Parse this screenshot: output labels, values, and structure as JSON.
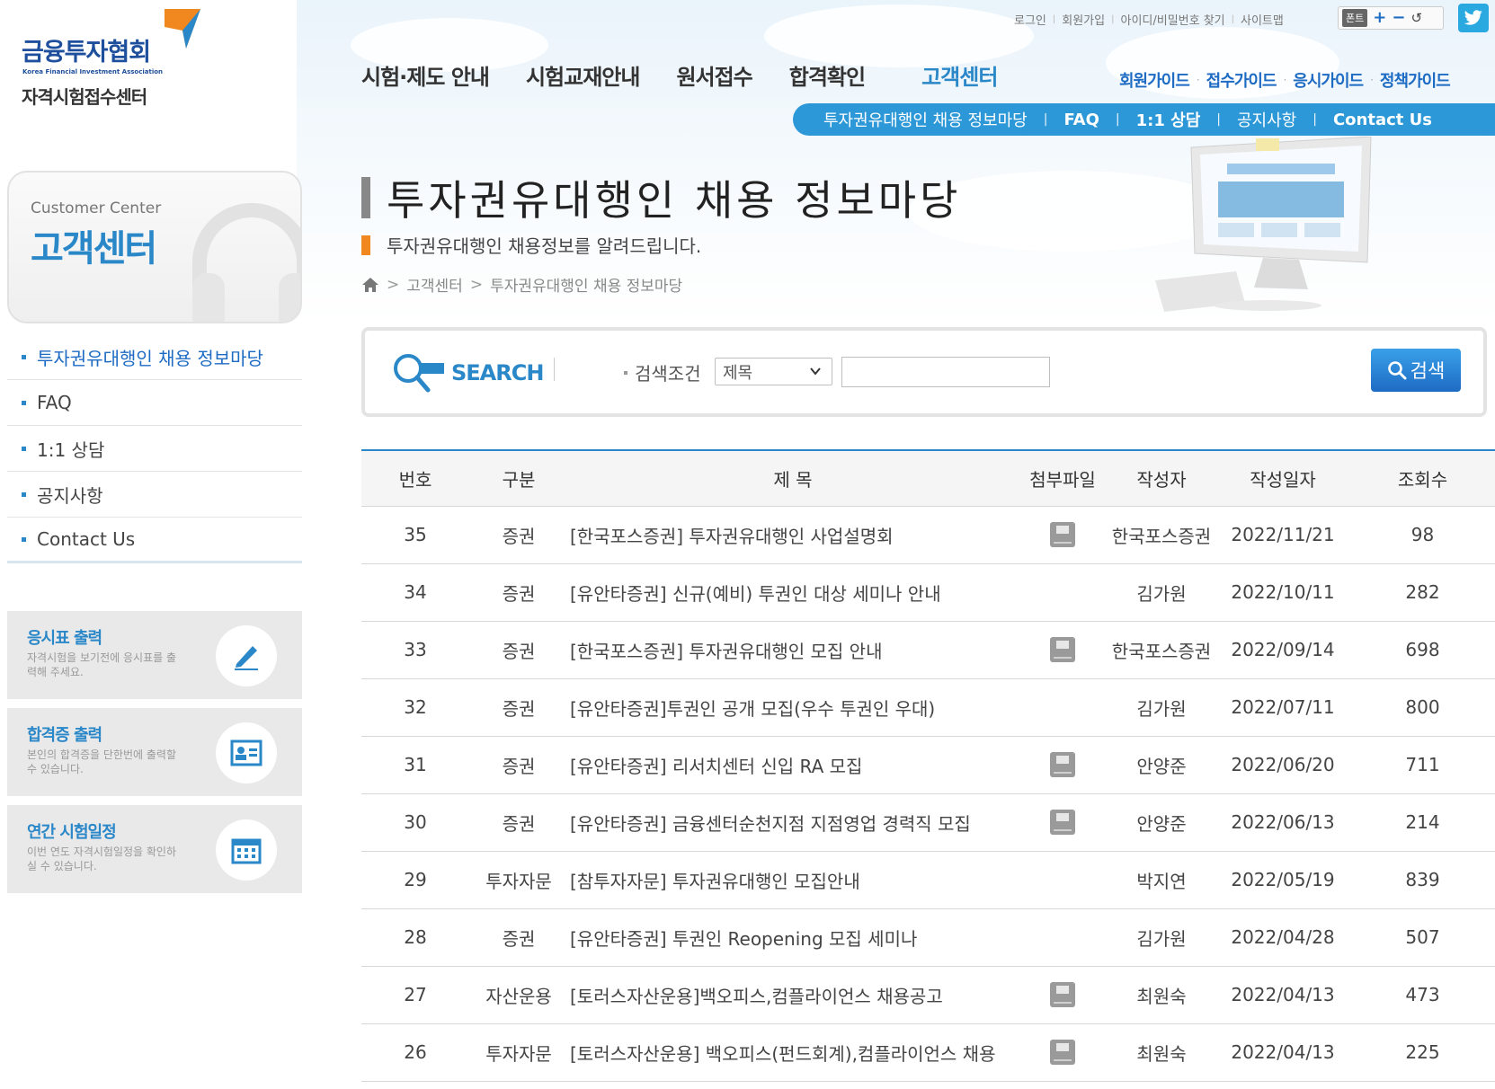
{
  "header": {
    "org_name": "금융투자협회",
    "org_name_en": "Korea Financial Investment Association",
    "center_name": "자격시험접수센터",
    "util_links": [
      "로그인",
      "회원가입",
      "아이디/비밀번호 찾기",
      "사이트맵"
    ],
    "font_control": {
      "label": "폰트",
      "plus": "+",
      "minus": "−",
      "reset": "↺"
    },
    "gnb": [
      "시험·제도 안내",
      "시험교재안내",
      "원서접수",
      "합격확인",
      "고객센터"
    ],
    "gnb_active_index": 4,
    "guides": [
      "회원가이드",
      "접수가이드",
      "응시가이드",
      "정책가이드"
    ],
    "subnav": [
      "투자권유대행인 채용 정보마당",
      "FAQ",
      "1:1 상담",
      "공지사항",
      "Contact Us"
    ]
  },
  "sidebar": {
    "title_en": "Customer Center",
    "title_ko": "고객센터",
    "menu": [
      {
        "label": "투자권유대행인 채용 정보마당",
        "active": true
      },
      {
        "label": "FAQ",
        "active": false
      },
      {
        "label": "1:1 상담",
        "active": false
      },
      {
        "label": "공지사항",
        "active": false
      },
      {
        "label": "Contact Us",
        "active": false
      }
    ],
    "quick": [
      {
        "title": "응시표 출력",
        "desc": "자격시험을 보기전에 응시표를 출력해 주세요.",
        "icon": "pen-icon"
      },
      {
        "title": "합격증 출력",
        "desc": "본인의 합격증을 단한번에 출력할 수 있습니다.",
        "icon": "certificate-icon"
      },
      {
        "title": "연간 시험일정",
        "desc": "이번 연도 자격시험일정을 확인하실 수 있습니다.",
        "icon": "calendar-icon"
      }
    ]
  },
  "main": {
    "title": "투자권유대행인 채용 정보마당",
    "subtitle": "투자권유대행인 채용정보를 알려드립니다.",
    "breadcrumb": [
      "고객센터",
      "투자권유대행인 채용 정보마당"
    ]
  },
  "search": {
    "logo_text": "SEARCH",
    "condition_label": "검색조건",
    "condition_value": "제목",
    "keyword": "",
    "button": "검색"
  },
  "board": {
    "columns": [
      "번호",
      "구분",
      "제 목",
      "첨부파일",
      "작성자",
      "작성일자",
      "조회수"
    ],
    "rows": [
      {
        "no": "35",
        "category": "증권",
        "subject": "[한국포스증권] 투자권유대행인 사업설명회",
        "file": true,
        "author": "한국포스증권",
        "date": "2022/11/21",
        "views": "98"
      },
      {
        "no": "34",
        "category": "증권",
        "subject": "[유안타증권] 신규(예비) 투권인 대상 세미나 안내",
        "file": false,
        "author": "김가원",
        "date": "2022/10/11",
        "views": "282"
      },
      {
        "no": "33",
        "category": "증권",
        "subject": "[한국포스증권] 투자권유대행인 모집 안내",
        "file": true,
        "author": "한국포스증권",
        "date": "2022/09/14",
        "views": "698"
      },
      {
        "no": "32",
        "category": "증권",
        "subject": "[유안타증권]투권인 공개 모집(우수 투권인 우대)",
        "file": false,
        "author": "김가원",
        "date": "2022/07/11",
        "views": "800"
      },
      {
        "no": "31",
        "category": "증권",
        "subject": "[유안타증권] 리서치센터 신입 RA 모집",
        "file": true,
        "author": "안양준",
        "date": "2022/06/20",
        "views": "711"
      },
      {
        "no": "30",
        "category": "증권",
        "subject": "[유안타증권] 금융센터순천지점 지점영업 경력직 모집",
        "file": true,
        "author": "안양준",
        "date": "2022/06/13",
        "views": "214"
      },
      {
        "no": "29",
        "category": "투자자문",
        "subject": "[참투자자문] 투자권유대행인 모집안내",
        "file": false,
        "author": "박지연",
        "date": "2022/05/19",
        "views": "839"
      },
      {
        "no": "28",
        "category": "증권",
        "subject": "[유안타증권] 투권인 Reopening 모집 세미나",
        "file": false,
        "author": "김가원",
        "date": "2022/04/28",
        "views": "507"
      },
      {
        "no": "27",
        "category": "자산운용",
        "subject": "[토러스자산운용]백오피스,컴플라이언스 채용공고",
        "file": true,
        "author": "최원숙",
        "date": "2022/04/13",
        "views": "473"
      },
      {
        "no": "26",
        "category": "투자자문",
        "subject": "[토러스자산운용] 백오피스(펀드회계),컴플라이언스 채용",
        "file": true,
        "author": "최원숙",
        "date": "2022/04/13",
        "views": "225"
      }
    ]
  },
  "colors": {
    "brand_blue": "#2a87c8",
    "accent_orange": "#f0881f",
    "button_blue": "#1e6bc4"
  }
}
